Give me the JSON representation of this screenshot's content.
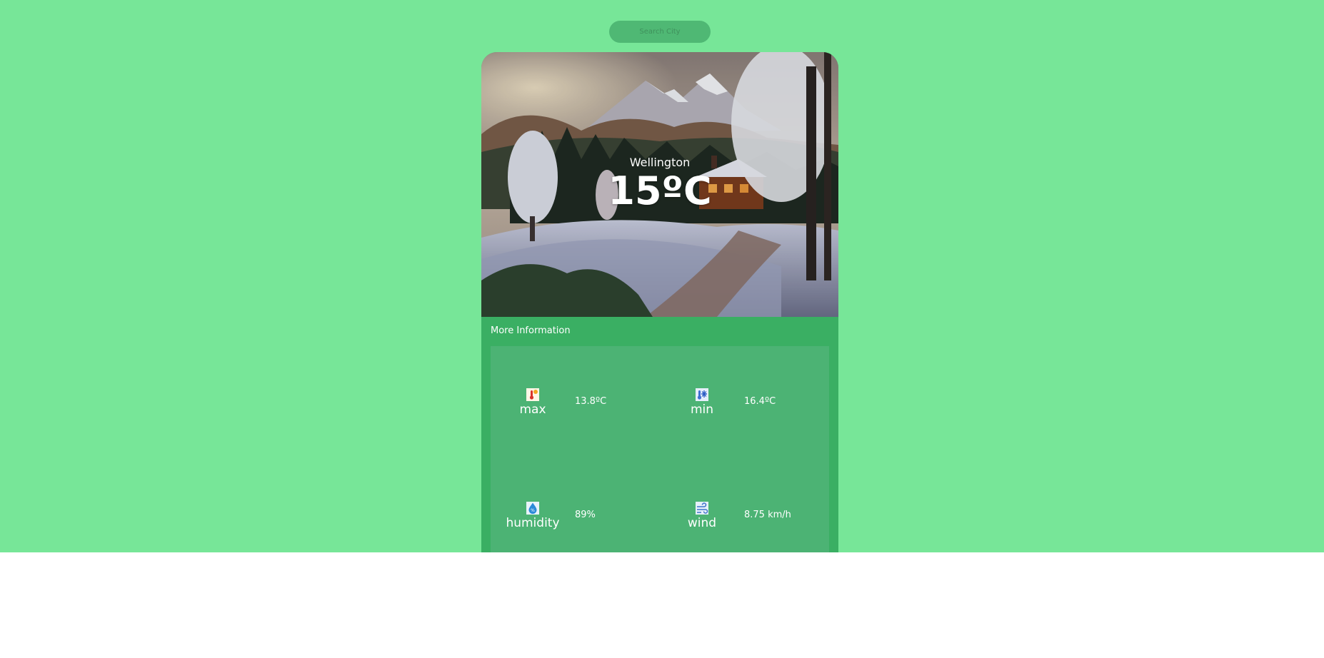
{
  "search": {
    "placeholder": "Search City"
  },
  "weather": {
    "city": "Wellington",
    "temperature": "15ºC"
  },
  "more_info": {
    "title": "More Information",
    "metrics": [
      {
        "name": "max",
        "value": "13.8ºC",
        "icon": "thermometer-hot-icon"
      },
      {
        "name": "min",
        "value": "16.4ºC",
        "icon": "thermometer-cold-icon"
      },
      {
        "name": "humidity",
        "value": "89%",
        "icon": "humidity-drop-icon"
      },
      {
        "name": "wind",
        "value": "8.75 km/h",
        "icon": "wind-icon"
      }
    ]
  },
  "colors": {
    "page_background": "#77e698",
    "card_background": "#3aaf63",
    "panel_background": "#4cb374",
    "search_background": "#4fb874",
    "text": "#ffffff"
  }
}
